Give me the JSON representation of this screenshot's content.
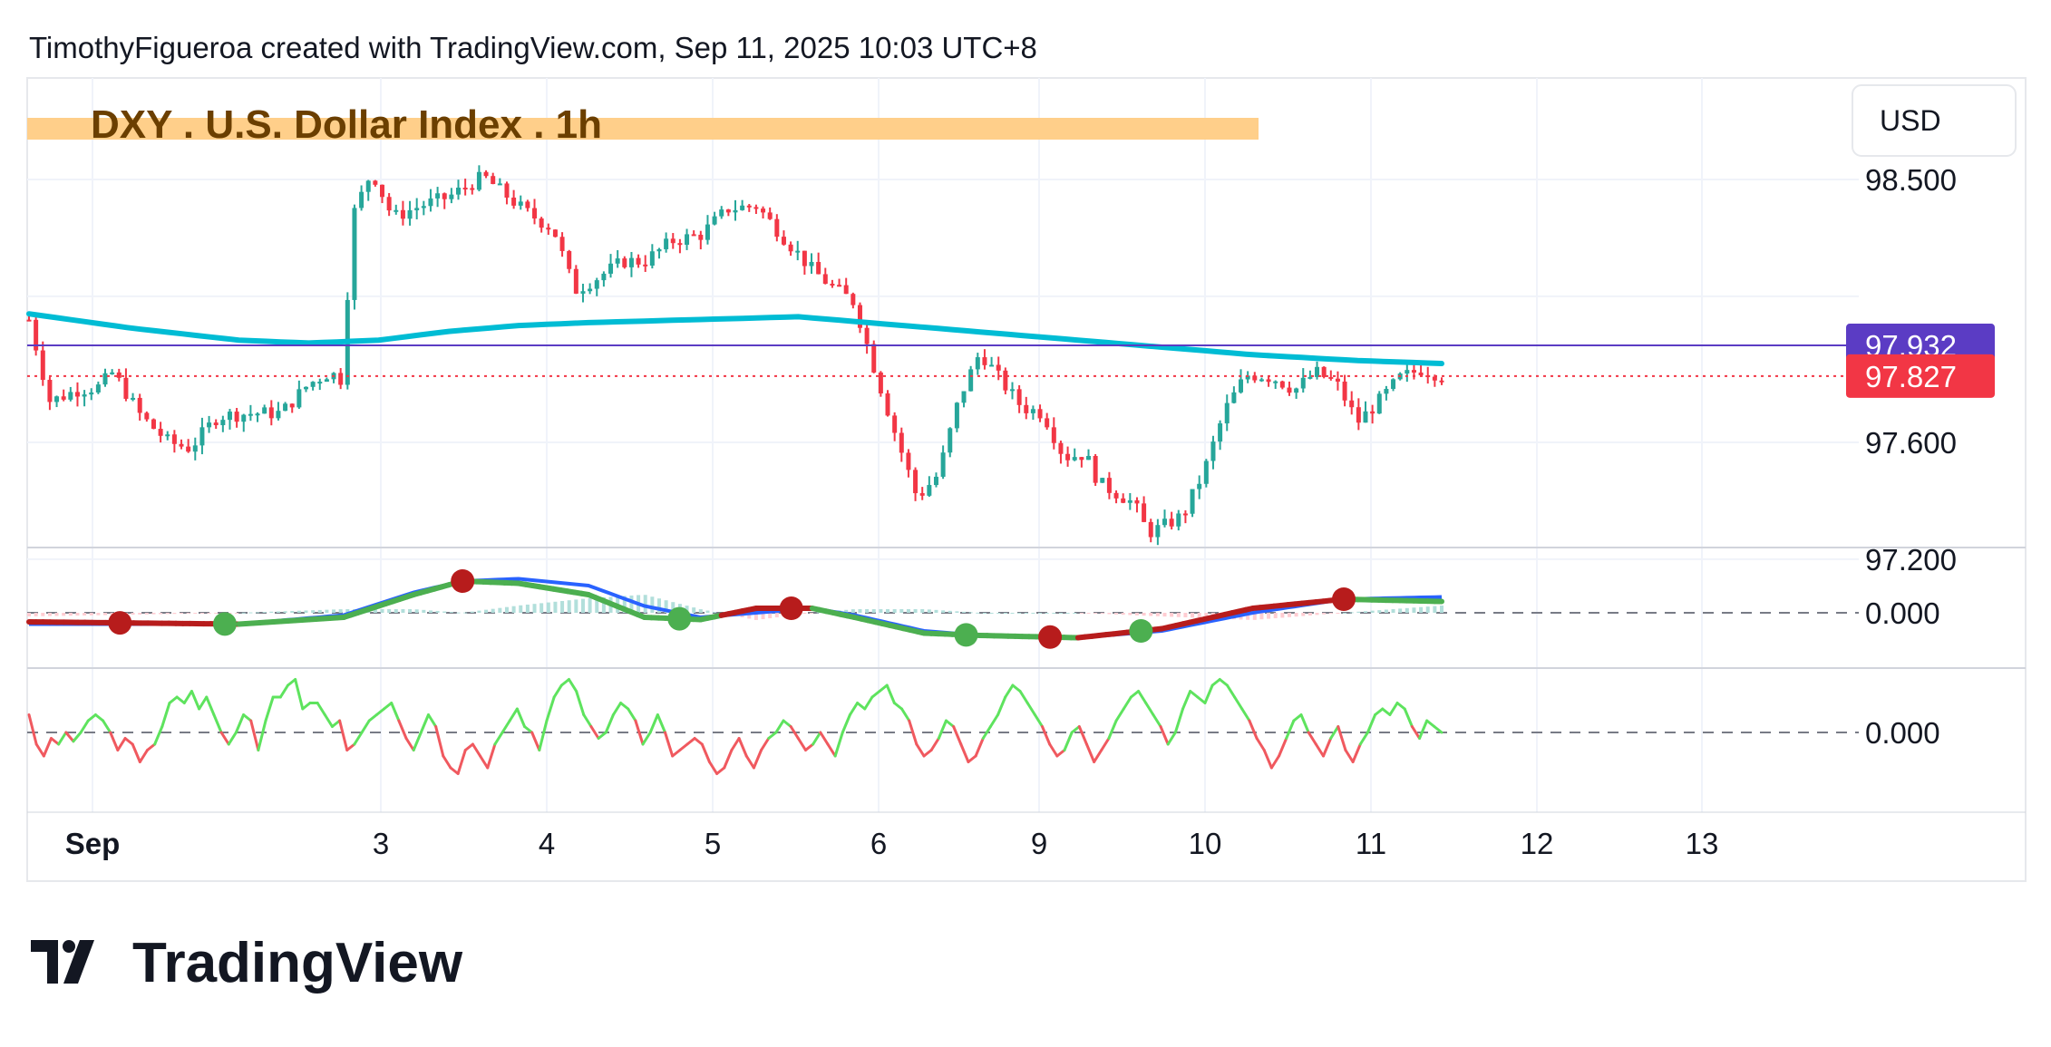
{
  "header": {
    "credit": "TimothyFigueroa created with TradingView.com, Sep 11, 2025 10:03 UTC+8"
  },
  "chart_title": "DXY . U.S. Dollar Index . 1h",
  "currency_button": "USD",
  "footer": {
    "brand": "TradingView"
  },
  "colors": {
    "bull": "#26a69a",
    "bear": "#f23645",
    "ma200": "#00bcd4",
    "reference_line": "#5b3cc4",
    "highlight": "#ffcf8a",
    "macd_line": "#2962ff",
    "signal_up": "#4caf50",
    "signal_down": "#b71c1c",
    "osc_up": "#5ee35e",
    "osc_down": "#f0595f"
  },
  "chart_data": [
    {
      "type": "candlestick",
      "title": "DXY . U.S. Dollar Index . 1h",
      "currency": "USD",
      "x_tick_labels": [
        "Sep",
        "3",
        "4",
        "5",
        "6",
        "9",
        "10",
        "11",
        "12",
        "13"
      ],
      "y_ticks": [
        98.5,
        97.6,
        97.2
      ],
      "y_tick_labels": [
        "98.500",
        "97.600",
        "97.200"
      ],
      "ylim": [
        97.0,
        98.75
      ],
      "price_labels": [
        {
          "value": 97.932,
          "text": "97.932",
          "color": "#5b3cc4"
        },
        {
          "value": 97.827,
          "text": "97.827",
          "color": "#f23645"
        }
      ],
      "horizontal_lines": [
        {
          "value": 97.932,
          "style": "solid",
          "color": "#5b3cc4"
        },
        {
          "value": 97.827,
          "style": "dotted",
          "color": "#f23645"
        }
      ],
      "price_path_close": [
        [
          0,
          98.02
        ],
        [
          3,
          97.74
        ],
        [
          7,
          97.78
        ],
        [
          10,
          97.79
        ],
        [
          12,
          97.84
        ],
        [
          16,
          97.69
        ],
        [
          20,
          97.6
        ],
        [
          23,
          97.58
        ],
        [
          27,
          97.69
        ],
        [
          32,
          97.7
        ],
        [
          36,
          97.7
        ],
        [
          40,
          97.8
        ],
        [
          43,
          97.84
        ],
        [
          45,
          97.81
        ],
        [
          46,
          98.36
        ],
        [
          49,
          98.53
        ],
        [
          52,
          98.37
        ],
        [
          56,
          98.41
        ],
        [
          60,
          98.44
        ],
        [
          65,
          98.51
        ],
        [
          68,
          98.45
        ],
        [
          71,
          98.39
        ],
        [
          75,
          98.33
        ],
        [
          78,
          98.12
        ],
        [
          81,
          98.16
        ],
        [
          85,
          98.22
        ],
        [
          88,
          98.22
        ],
        [
          92,
          98.29
        ],
        [
          96,
          98.31
        ],
        [
          100,
          98.4
        ],
        [
          104,
          98.41
        ],
        [
          108,
          98.3
        ],
        [
          112,
          98.19
        ],
        [
          115,
          98.13
        ],
        [
          118,
          98.08
        ],
        [
          120,
          97.92
        ],
        [
          124,
          97.62
        ],
        [
          127,
          97.41
        ],
        [
          130,
          97.49
        ],
        [
          133,
          97.75
        ],
        [
          136,
          97.91
        ],
        [
          139,
          97.81
        ],
        [
          142,
          97.72
        ],
        [
          145,
          97.7
        ],
        [
          148,
          97.55
        ],
        [
          151,
          97.56
        ],
        [
          153,
          97.46
        ],
        [
          156,
          97.42
        ],
        [
          158,
          97.39
        ],
        [
          160,
          97.29
        ],
        [
          162,
          97.31
        ],
        [
          165,
          97.35
        ],
        [
          168,
          97.5
        ],
        [
          171,
          97.71
        ],
        [
          174,
          97.83
        ],
        [
          176,
          97.83
        ],
        [
          178,
          97.82
        ],
        [
          181,
          97.78
        ],
        [
          184,
          97.84
        ],
        [
          187,
          97.8
        ],
        [
          190,
          97.67
        ],
        [
          193,
          97.74
        ],
        [
          196,
          97.82
        ],
        [
          199,
          97.85
        ],
        [
          202,
          97.83
        ]
      ],
      "ma200_path": [
        [
          0,
          98.04
        ],
        [
          15,
          97.99
        ],
        [
          30,
          97.95
        ],
        [
          40,
          97.94
        ],
        [
          50,
          97.95
        ],
        [
          60,
          97.98
        ],
        [
          70,
          98.0
        ],
        [
          80,
          98.01
        ],
        [
          95,
          98.02
        ],
        [
          110,
          98.03
        ],
        [
          120,
          98.01
        ],
        [
          130,
          97.99
        ],
        [
          145,
          97.96
        ],
        [
          160,
          97.93
        ],
        [
          175,
          97.9
        ],
        [
          190,
          97.88
        ],
        [
          202,
          97.87
        ]
      ],
      "candles": {
        "count": 205,
        "session_start_slots": [
          0,
          11,
          35,
          58,
          80,
          103,
          126,
          151,
          175,
          197
        ]
      }
    },
    {
      "type": "line",
      "name": "MACD",
      "y_tick_labels": [
        "0.000"
      ],
      "baseline": 0,
      "ylim": [
        -0.17,
        0.17
      ],
      "macd": [
        [
          0,
          -0.05
        ],
        [
          30,
          -0.05
        ],
        [
          45,
          -0.01
        ],
        [
          55,
          0.09
        ],
        [
          62,
          0.14
        ],
        [
          70,
          0.15
        ],
        [
          80,
          0.12
        ],
        [
          88,
          0.03
        ],
        [
          96,
          -0.02
        ],
        [
          104,
          0.0
        ],
        [
          112,
          0.02
        ],
        [
          118,
          -0.01
        ],
        [
          128,
          -0.08
        ],
        [
          136,
          -0.1
        ],
        [
          150,
          -0.11
        ],
        [
          162,
          -0.08
        ],
        [
          175,
          0.0
        ],
        [
          188,
          0.06
        ],
        [
          202,
          0.07
        ]
      ],
      "signal": [
        [
          0,
          -0.04
        ],
        [
          30,
          -0.05
        ],
        [
          45,
          -0.02
        ],
        [
          55,
          0.08
        ],
        [
          62,
          0.14
        ],
        [
          70,
          0.13
        ],
        [
          80,
          0.08
        ],
        [
          88,
          -0.02
        ],
        [
          96,
          -0.03
        ],
        [
          104,
          0.02
        ],
        [
          112,
          0.02
        ],
        [
          118,
          -0.02
        ],
        [
          128,
          -0.09
        ],
        [
          136,
          -0.1
        ],
        [
          150,
          -0.11
        ],
        [
          162,
          -0.07
        ],
        [
          175,
          0.02
        ],
        [
          188,
          0.06
        ],
        [
          202,
          0.05
        ]
      ],
      "signal_cross_markers": [
        {
          "x": 13,
          "direction": "down"
        },
        {
          "x": 28,
          "direction": "up"
        },
        {
          "x": 62,
          "direction": "down"
        },
        {
          "x": 93,
          "direction": "up"
        },
        {
          "x": 109,
          "direction": "down"
        },
        {
          "x": 134,
          "direction": "up"
        },
        {
          "x": 146,
          "direction": "down"
        },
        {
          "x": 159,
          "direction": "up"
        },
        {
          "x": 188,
          "direction": "down"
        }
      ]
    },
    {
      "type": "line",
      "name": "Oscillator",
      "y_tick_labels": [
        "0.000"
      ],
      "baseline": 0,
      "ylim": [
        -1,
        1
      ],
      "values": [
        0.3,
        -0.2,
        -0.4,
        -0.1,
        -0.2,
        0.0,
        -0.15,
        0.0,
        0.2,
        0.3,
        0.2,
        0.0,
        -0.3,
        -0.1,
        -0.2,
        -0.5,
        -0.3,
        -0.2,
        0.1,
        0.5,
        0.6,
        0.5,
        0.7,
        0.4,
        0.6,
        0.3,
        0.0,
        -0.2,
        0.0,
        0.3,
        0.2,
        -0.3,
        0.2,
        0.6,
        0.6,
        0.8,
        0.9,
        0.4,
        0.5,
        0.5,
        0.3,
        0.1,
        0.2,
        -0.3,
        -0.2,
        0.0,
        0.2,
        0.3,
        0.4,
        0.5,
        0.2,
        -0.1,
        -0.3,
        0.0,
        0.3,
        0.1,
        -0.4,
        -0.6,
        -0.7,
        -0.3,
        -0.2,
        -0.4,
        -0.6,
        -0.2,
        0.0,
        0.2,
        0.4,
        0.1,
        0.0,
        -0.3,
        0.2,
        0.6,
        0.8,
        0.9,
        0.7,
        0.3,
        0.1,
        -0.1,
        0.0,
        0.3,
        0.5,
        0.4,
        0.2,
        -0.2,
        0.0,
        0.3,
        0.0,
        -0.4,
        -0.3,
        -0.2,
        -0.1,
        -0.2,
        -0.5,
        -0.7,
        -0.6,
        -0.3,
        -0.1,
        -0.4,
        -0.6,
        -0.3,
        -0.1,
        0.0,
        0.2,
        0.1,
        -0.1,
        -0.3,
        -0.2,
        0.0,
        -0.2,
        -0.4,
        0.0,
        0.3,
        0.5,
        0.4,
        0.6,
        0.7,
        0.8,
        0.5,
        0.4,
        0.2,
        -0.2,
        -0.4,
        -0.3,
        -0.1,
        0.2,
        0.1,
        -0.2,
        -0.5,
        -0.4,
        -0.1,
        0.1,
        0.3,
        0.6,
        0.8,
        0.7,
        0.5,
        0.3,
        0.1,
        -0.2,
        -0.4,
        -0.3,
        0.0,
        0.1,
        -0.2,
        -0.5,
        -0.3,
        -0.1,
        0.2,
        0.4,
        0.6,
        0.7,
        0.5,
        0.3,
        0.1,
        -0.2,
        0.0,
        0.4,
        0.7,
        0.6,
        0.5,
        0.8,
        0.9,
        0.8,
        0.6,
        0.4,
        0.2,
        -0.1,
        -0.3,
        -0.6,
        -0.4,
        -0.1,
        0.2,
        0.3,
        0.0,
        -0.2,
        -0.4,
        -0.1,
        0.1,
        -0.3,
        -0.5,
        -0.2,
        0.0,
        0.3,
        0.4,
        0.3,
        0.5,
        0.4,
        0.1,
        -0.1,
        0.2,
        0.1,
        0.0
      ]
    }
  ]
}
